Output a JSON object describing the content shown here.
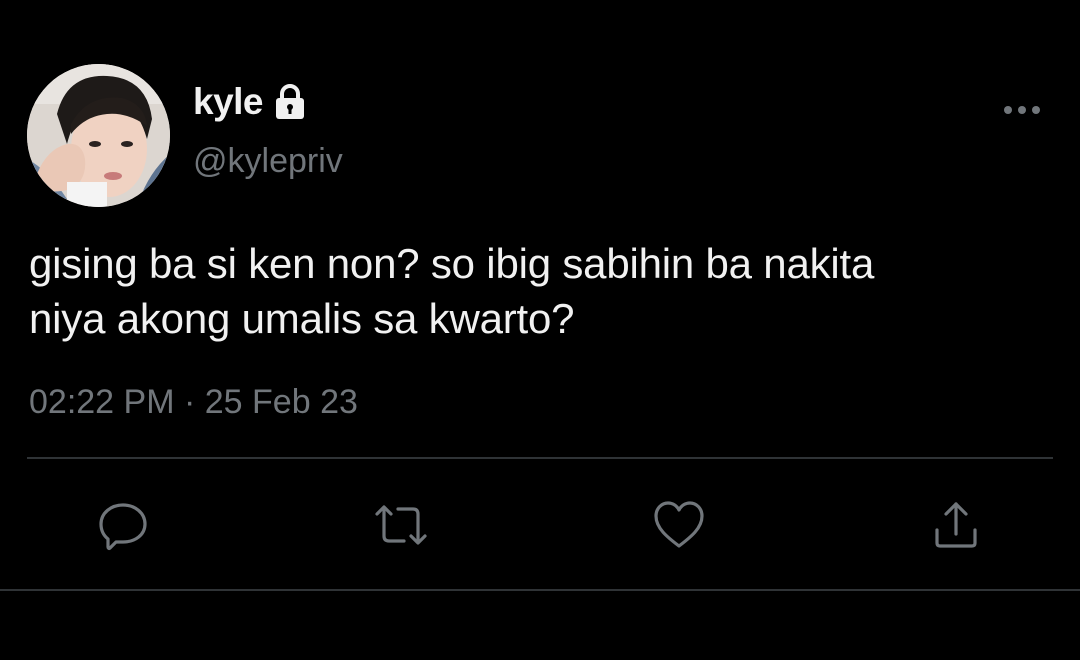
{
  "user": {
    "display_name": "kyle",
    "handle": "@kylepriv",
    "protected": true
  },
  "tweet": {
    "lines": [
      "gising ba si ken non? so ibig sabihin ba nakita",
      "niya akong umalis sa kwarto?"
    ],
    "time": "02:22 PM",
    "separator": "·",
    "date": "25 Feb 23"
  },
  "actions": [
    {
      "icon": "reply-icon"
    },
    {
      "icon": "retweet-icon"
    },
    {
      "icon": "like-icon"
    },
    {
      "icon": "share-icon"
    }
  ],
  "colors": {
    "background": "#000000",
    "text_primary": "#f1f1f1",
    "text_secondary": "#71767b",
    "icon": "#71767b",
    "divider": "#2f3336"
  }
}
